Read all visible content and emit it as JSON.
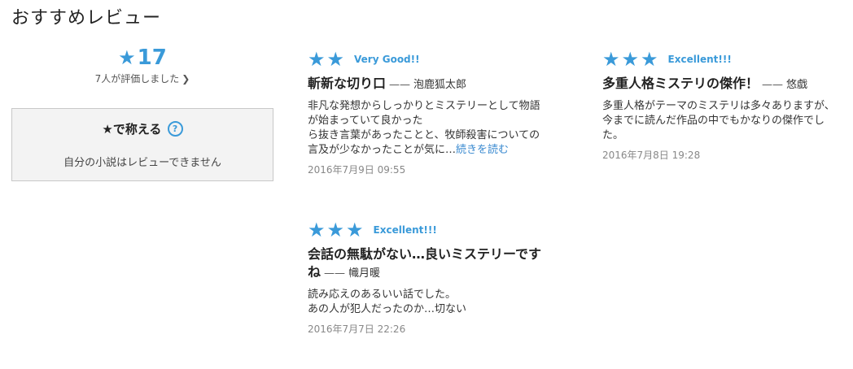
{
  "section_title": "おすすめレビュー",
  "summary": {
    "star": "★",
    "score": "17",
    "count_text": "7人が評価しました",
    "chevron": "❯"
  },
  "praise": {
    "star": "★",
    "title": "で称える",
    "help": "?",
    "note": "自分の小説はレビューできません"
  },
  "colors": {
    "accent": "#3a9ad9",
    "link": "#3a8ad0"
  },
  "reviews": [
    {
      "stars": "★★",
      "label": "Very Good!!",
      "title": "斬新な切り口",
      "dash": "——",
      "author": "泡鹿狐太郎",
      "body_lines": [
        "非凡な発想からしっかりとミステリーとして物語",
        "が始まっていて良かった",
        "ら抜き言葉があったことと、牧師殺害についての",
        "言及が少なかったことが気に…"
      ],
      "more": "続きを読む",
      "date": "2016年7月9日 09:55"
    },
    {
      "stars": "★★★",
      "label": "Excellent!!!",
      "title": "多重人格ミステリの傑作！",
      "dash": "——",
      "author": "悠戯",
      "body_lines": [
        "多重人格がテーマのミステリは多々ありますが、",
        "今までに読んだ作品の中でもかなりの傑作でし",
        "た。"
      ],
      "date": "2016年7月8日 19:28"
    },
    {
      "stars": "★★★",
      "label": "Excellent!!!",
      "title_line1": "会話の無駄がない…良いミステリーです",
      "title_line2": "ね",
      "dash": "——",
      "author": "幟月暖",
      "body_lines": [
        "読み応えのあるいい話でした。",
        "あの人が犯人だったのか…切ない"
      ],
      "date": "2016年7月7日 22:26"
    }
  ]
}
